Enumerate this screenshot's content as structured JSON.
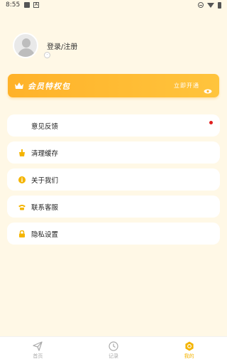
{
  "status_bar": {
    "time": "8:55",
    "icons": [
      "photo-icon",
      "a-icon",
      "minus-circle-icon",
      "wifi-icon",
      "battery-icon"
    ]
  },
  "profile": {
    "login_label": "登录/注册",
    "avatar_icon": "default-avatar-icon"
  },
  "vip": {
    "title": "会员特权包",
    "action": "立即开通",
    "icon": "crown-icon",
    "accent": "#FFB229"
  },
  "menu": [
    {
      "label": "意见反馈",
      "icon": "",
      "badge": true
    },
    {
      "label": "清理缓存",
      "icon": "broom-icon",
      "badge": false
    },
    {
      "label": "关于我们",
      "icon": "info-icon",
      "badge": false
    },
    {
      "label": "联系客服",
      "icon": "phone-icon",
      "badge": false
    },
    {
      "label": "隐私设置",
      "icon": "lock-icon",
      "badge": false
    }
  ],
  "tabs": [
    {
      "label": "首页",
      "icon": "paper-plane-icon",
      "active": false
    },
    {
      "label": "记录",
      "icon": "clock-icon",
      "active": false
    },
    {
      "label": "我的",
      "icon": "profile-hex-icon",
      "active": true
    }
  ],
  "colors": {
    "background": "#FFF8E6",
    "accent": "#F4B400",
    "badge": "#E02020"
  }
}
